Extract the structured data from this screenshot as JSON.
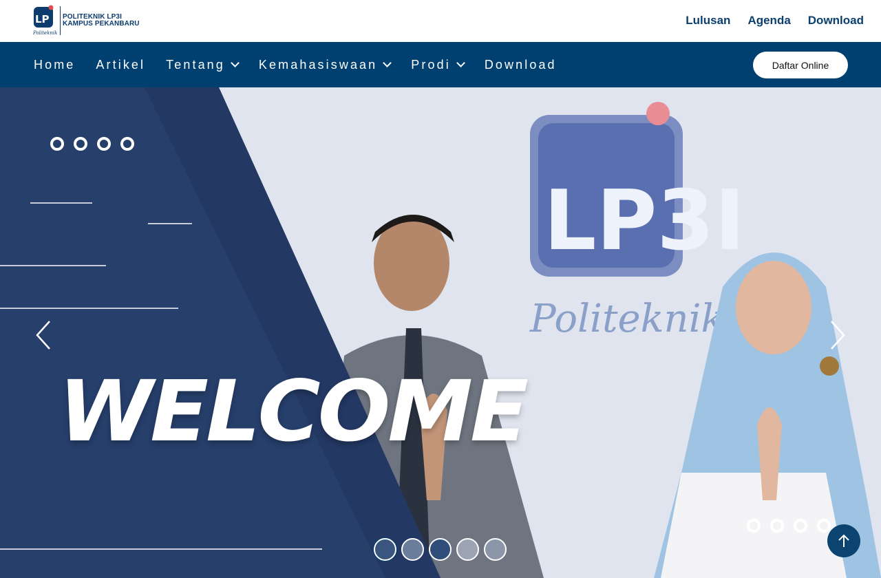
{
  "brand": {
    "logo_text_line1": "POLITEKNIK LP3I",
    "logo_text_line2": "KAMPUS PEKANBARU",
    "logo_script": "Politeknik"
  },
  "top_links": [
    "Lulusan",
    "Agenda",
    "Download"
  ],
  "nav": {
    "items": [
      {
        "label": "Home",
        "dropdown": false
      },
      {
        "label": "Artikel",
        "dropdown": false
      },
      {
        "label": "Tentang",
        "dropdown": true
      },
      {
        "label": "Kemahasiswaan",
        "dropdown": true
      },
      {
        "label": "Prodi",
        "dropdown": true
      },
      {
        "label": "Download",
        "dropdown": false
      }
    ],
    "cta_label": "Daftar Online"
  },
  "hero": {
    "headline": "WELCOME",
    "sign_text": "LP3I",
    "sign_script": "Politeknik",
    "thumbnail_count": 5,
    "active_thumbnail": 1
  },
  "colors": {
    "primary": "#004070",
    "hero_panel": "#263f6b",
    "link": "#0b3f6e"
  },
  "icons": [
    "chevron-down-icon",
    "chevron-left-icon",
    "chevron-right-icon",
    "arrow-up-icon"
  ]
}
